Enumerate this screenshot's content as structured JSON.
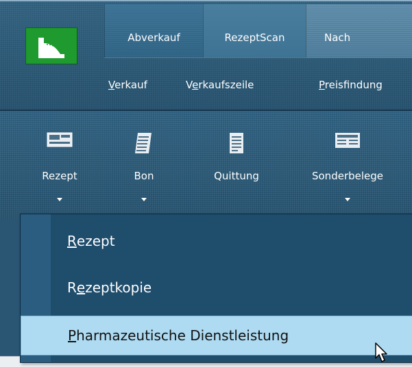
{
  "header": {
    "tabs": [
      {
        "label": "Abverkauf",
        "state": "active"
      },
      {
        "label": "RezeptScan",
        "state": "normal"
      },
      {
        "label": "Nach",
        "state": "light"
      }
    ],
    "subnav": [
      {
        "pre": "",
        "u": "V",
        "post": "erkauf"
      },
      {
        "pre": "V",
        "u": "e",
        "post": "rkaufszeile"
      },
      {
        "pre": "",
        "u": "P",
        "post": "reisfindung"
      }
    ]
  },
  "toolbar": {
    "items": [
      {
        "label": "Rezept",
        "icon": "rezept-icon",
        "has_dropdown": true
      },
      {
        "label": "Bon",
        "icon": "receipt-icon",
        "has_dropdown": true
      },
      {
        "label": "Quittung",
        "icon": "document-icon",
        "has_dropdown": false
      },
      {
        "label": "Sonderbelege",
        "icon": "special-doc-icon",
        "has_dropdown": true
      }
    ]
  },
  "menu": {
    "items": [
      {
        "pre": "",
        "u": "R",
        "post": "ezept",
        "state": "normal"
      },
      {
        "pre": "R",
        "u": "e",
        "post": "zeptkopie",
        "state": "normal"
      },
      {
        "pre": "",
        "u": "P",
        "post": "harmazeutische Dienstleistung",
        "state": "hover"
      }
    ]
  },
  "colors": {
    "header_bg": "#2a5a78",
    "menu_bg": "#1f4d6c",
    "menu_hover": "#aedbf2",
    "logo_green": "#1f9a2e"
  }
}
